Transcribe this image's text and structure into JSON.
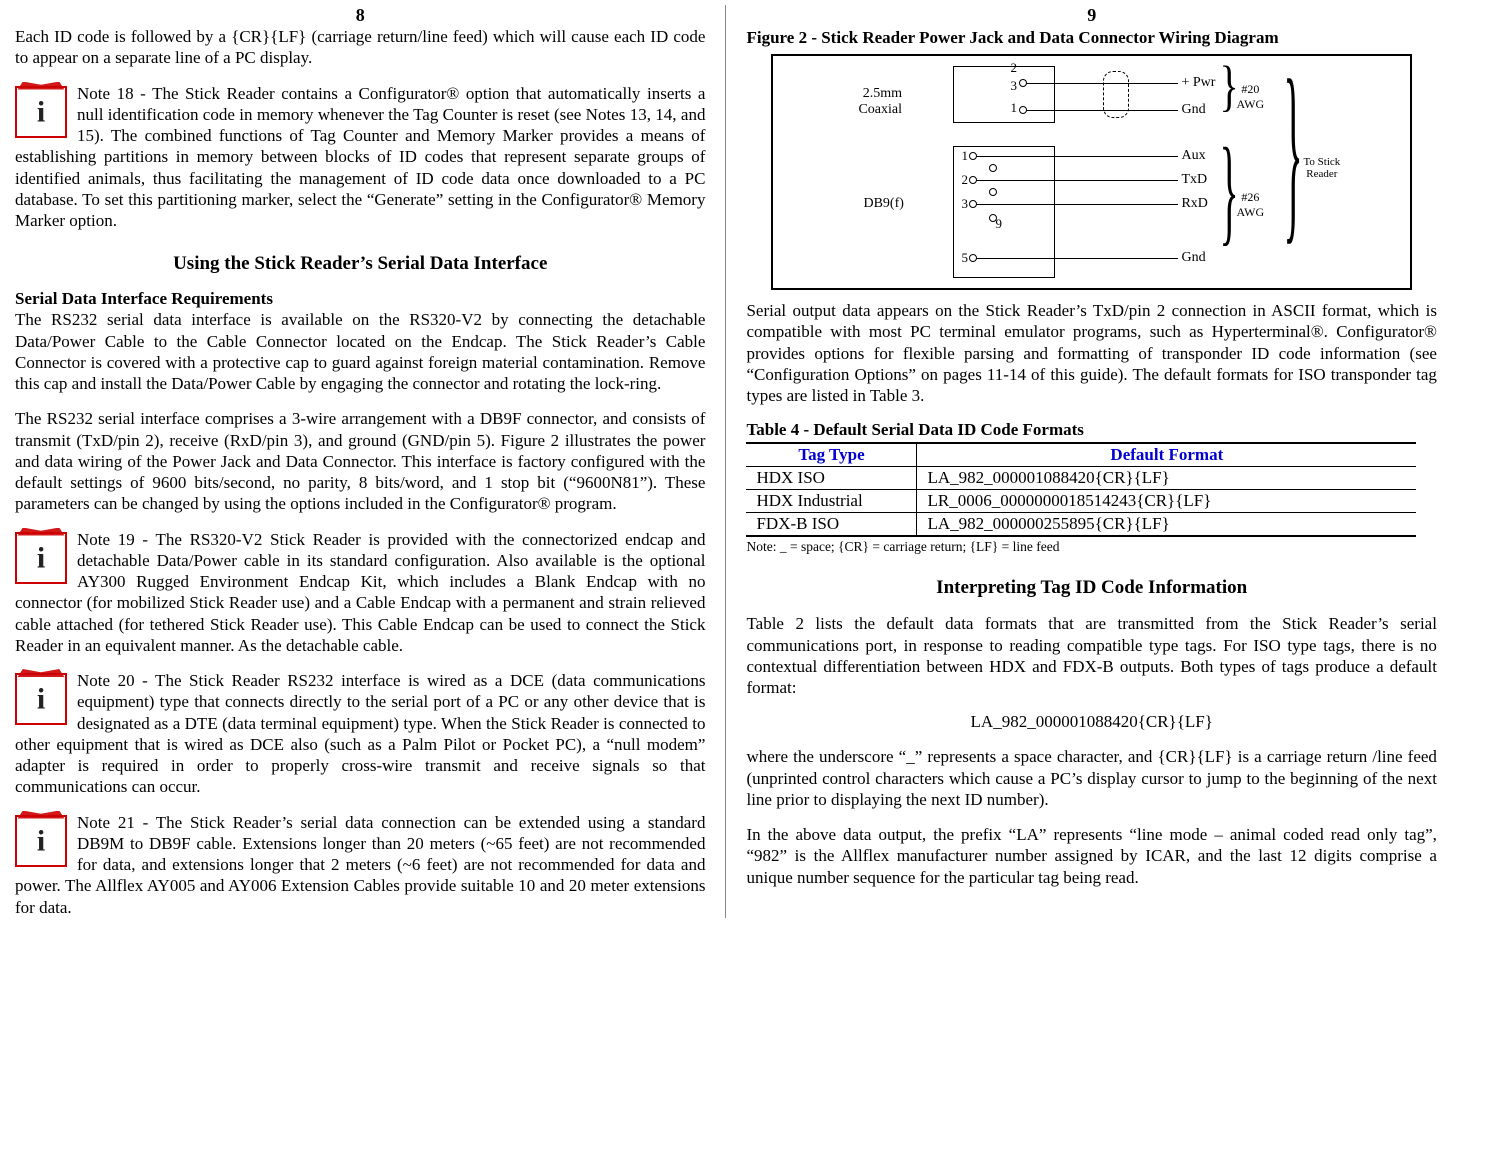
{
  "left": {
    "pageNum": "8",
    "intro": "Each ID code is followed by a {CR}{LF} (carriage return/line feed) which will cause each ID code to appear on a separate line of a PC display.",
    "note18": "Note 18  -  The Stick Reader contains a Configurator® option that automatically inserts a null identification code in memory whenever the Tag Counter is reset (see Notes 13, 14, and 15).  The combined functions of Tag Counter and Memory Marker provides a means of establishing partitions in memory between blocks of ID codes that represent separate groups of identified animals, thus facilitating the management of ID code data once downloaded to a PC database.  To set this partitioning marker, select the “Generate” setting in the Configurator® Memory Marker option.",
    "h_serial": "Using the Stick Reader’s Serial Data Interface",
    "h_req": "Serial Data Interface Requirements",
    "p_req": "The RS232 serial data interface is available on the RS320-V2 by connecting the detachable Data/Power Cable to the Cable Connector located on the Endcap.  The Stick Reader’s Cable Connector is covered with a protective cap to guard against foreign material contamination.  Remove this cap and install the Data/Power Cable by engaging the connector and rotating the lock-ring.",
    "p_iface": "The RS232 serial interface comprises a 3-wire arrangement with a DB9F connector, and consists of transmit (TxD/pin 2), receive (RxD/pin 3), and ground (GND/pin 5).  Figure 2 illustrates the power and data wiring of the Power Jack and Data Connector.  This interface is factory configured with the default settings of 9600 bits/second, no parity, 8 bits/word, and 1 stop bit (“9600N81”).  These parameters can be changed by using the options included in the Configurator® program.",
    "note19": "Note 19  -  The RS320-V2 Stick Reader is provided with the connectorized endcap and detachable Data/Power cable in its standard configuration.  Also available is the optional AY300 Rugged Environment Endcap Kit, which includes a Blank Endcap with no connector (for mobilized Stick Reader use) and a Cable Endcap with a permanent and strain relieved cable attached (for tethered Stick Reader use).  This Cable Endcap can be used to connect the Stick Reader in an equivalent manner. As the detachable cable.",
    "note20": "Note 20  -  The Stick Reader RS232 interface is wired as a DCE (data communications equipment) type that connects directly to the serial port of a PC or any other device that is designated as a DTE (data terminal equipment) type.  When the Stick Reader is connected to other equipment that is wired as DCE also (such as a Palm Pilot or Pocket PC), a “null modem” adapter is required in order to properly cross-wire transmit and receive signals so that communications can occur.",
    "note21": "Note 21  -  The Stick Reader’s serial data connection can be extended using a standard DB9M to DB9F cable. Extensions longer than 20 meters (~65 feet) are not recommended for data, and extensions longer that 2 meters (~6 feet) are not recommended for data and power.  The Allflex AY005 and AY006 Extension Cables provide suitable 10 and 20 meter extensions for data."
  },
  "right": {
    "pageNum": "9",
    "figCaption": "Figure 2  -   Stick Reader Power Jack and Data Connector Wiring Diagram",
    "fig": {
      "coax": "2.5mm\nCoaxial",
      "db9": "DB9(f)",
      "pins_top": [
        "2",
        "3",
        "1"
      ],
      "pins_db": [
        "1",
        "2",
        "3",
        "9",
        "5"
      ],
      "sigs": [
        "+ Pwr",
        "Gnd",
        "Aux",
        "TxD",
        "RxD",
        "Gnd"
      ],
      "awg1": "#20\nAWG",
      "awg2": "#26\nAWG",
      "dest": "To Stick\nReader"
    },
    "p_serial": "Serial output data appears on the Stick Reader’s TxD/pin 2 connection in ASCII format, which is compatible with most PC terminal emulator programs, such as Hyperterminal®.  Configurator® provides options for flexible parsing and formatting of transponder ID code information (see “Configuration Options” on pages 11-14 of this guide).  The default formats for ISO transponder tag types are listed in Table 3.",
    "tblCaption": "Table 4  - Default Serial Data ID Code Formats",
    "th1": "Tag Type",
    "th2": "Default Format",
    "rows": [
      {
        "t": "HDX ISO",
        "f": "LA_982_000001088420{CR}{LF}"
      },
      {
        "t": "HDX Industrial",
        "f": "LR_0006_0000000018514243{CR}{LF}"
      },
      {
        "t": "FDX-B ISO",
        "f": "LA_982_000000255895{CR}{LF}"
      }
    ],
    "tnote": "Note:  _ = space; {CR} = carriage return; {LF} = line feed",
    "h_interp": "Interpreting Tag ID Code Information",
    "p_t2": "Table 2 lists the default data formats that are transmitted from the Stick Reader’s serial communications port, in response to reading compatible type tags.  For ISO type tags, there is no contextual differentiation between HDX and FDX-B outputs.  Both types of tags produce a default format:",
    "sample": "LA_982_000001088420{CR}{LF}",
    "p_where": "where the underscore “_” represents a space character, and {CR}{LF} is a carriage return /line feed (unprinted control characters which cause a PC’s display cursor to jump to the beginning of the next line prior to displaying the next ID number).",
    "p_above": "In the above data output, the prefix “LA” represents “line mode – animal coded read only tag”, “982” is the Allflex manufacturer number assigned by ICAR, and the last 12 digits comprise a unique number sequence for the particular tag being read."
  }
}
